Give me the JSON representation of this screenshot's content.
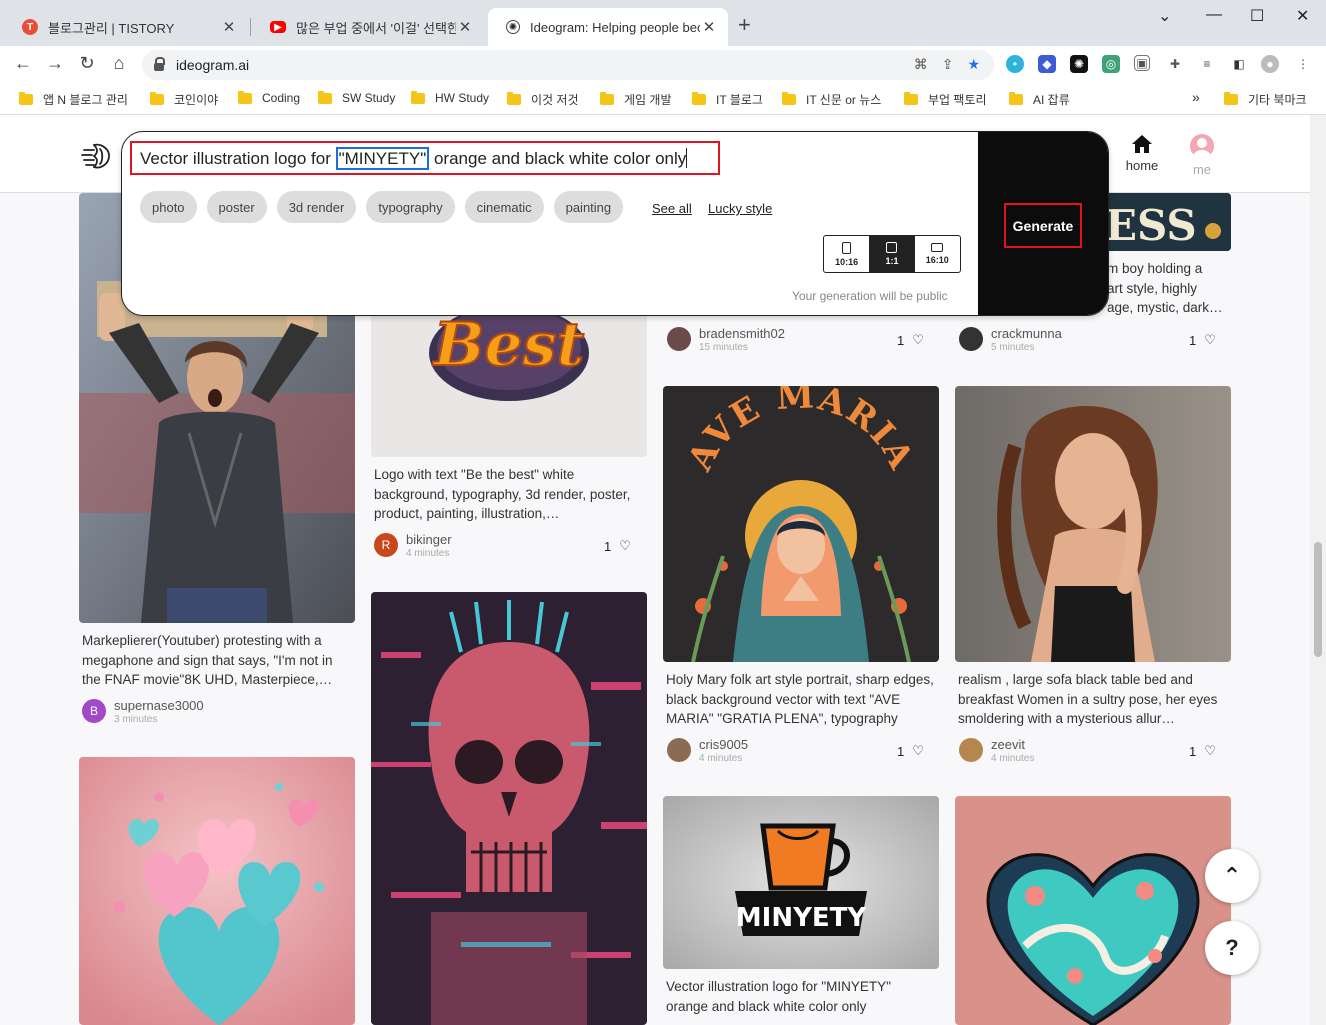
{
  "browser": {
    "tabs": [
      {
        "title": "블로그관리 | TISTORY",
        "favicon": "tistory-icon"
      },
      {
        "title": "많은 부업 중에서 '이걸' 선택한 ",
        "favicon": "youtube-icon"
      },
      {
        "title": "Ideogram: Helping people beco",
        "favicon": "ideogram-icon"
      }
    ],
    "url": "ideogram.ai",
    "bookmarks": [
      "앱 N 블로그 관리",
      "코인이야",
      "Coding",
      "SW Study",
      "HW Study",
      "이것 저것",
      "게임 개발",
      "IT 블로그",
      "IT 신문 or 뉴스",
      "부업 팩토리",
      "AI 잡류"
    ],
    "bookmarks_more": "»",
    "other_bookmarks": "기타 북마크"
  },
  "header": {
    "home_label": "home",
    "me_label": "me"
  },
  "generator": {
    "prompt_before": "Vector illustration logo for ",
    "prompt_highlight": "\"MINYETY\"",
    "prompt_after": " orange and black white color only",
    "chips": [
      "photo",
      "poster",
      "3d render",
      "typography",
      "cinematic",
      "painting"
    ],
    "see_all": "See all",
    "lucky_style": "Lucky style",
    "ratios": [
      {
        "label": "10:16",
        "selected": false
      },
      {
        "label": "1:1",
        "selected": true
      },
      {
        "label": "16:10",
        "selected": false
      }
    ],
    "public_note": "Your generation will be public",
    "generate_label": "Generate"
  },
  "cards": {
    "c_markiplier": {
      "desc": "Markeplierer(Youtuber) protesting with a megaphone and sign that says, \"I'm not in the FNAF movie\"8K UHD, Masterpiece,…",
      "author": "supernase3000",
      "initial": "B",
      "time": "3 minutes"
    },
    "c_best": {
      "image_text": "Best",
      "desc": "Logo with text \"Be the best\" white background, typography, 3d render, poster, product, painting, illustration,…",
      "author": "bikinger",
      "initial": "R",
      "time": "4 minutes",
      "likes": "1"
    },
    "c_bradens": {
      "author": "bradensmith02",
      "time": "15 minutes",
      "likes": "1"
    },
    "c_crack": {
      "image_text": "ESS",
      "desc": "m boy holding a\nart style, highly\nage, mystic, dark…",
      "author": "crackmunna",
      "time": "5 minutes",
      "likes": "1"
    },
    "c_avemaria": {
      "image_text": "AVE MARIA",
      "desc": "Holy Mary folk art style portrait, sharp edges, black background vector with text \"AVE MARIA\" \"GRATIA PLENA\", typography",
      "author": "cris9005",
      "time": "4 minutes",
      "likes": "1"
    },
    "c_sofa": {
      "desc": "realism , large sofa black table bed and breakfast Women in a sultry pose, her eyes smoldering with a mysterious allur…",
      "author": "zeevit",
      "time": "4 minutes",
      "likes": "1"
    },
    "c_minyety": {
      "image_text": "MINYETY",
      "desc": "Vector illustration logo for \"MINYETY\" orange and black white color only"
    }
  },
  "fab": {
    "help": "?"
  },
  "colors": {
    "highlight_red": "#e0141e",
    "highlight_blue": "#1a6fe0",
    "panel_dark": "#0c0c0c"
  }
}
